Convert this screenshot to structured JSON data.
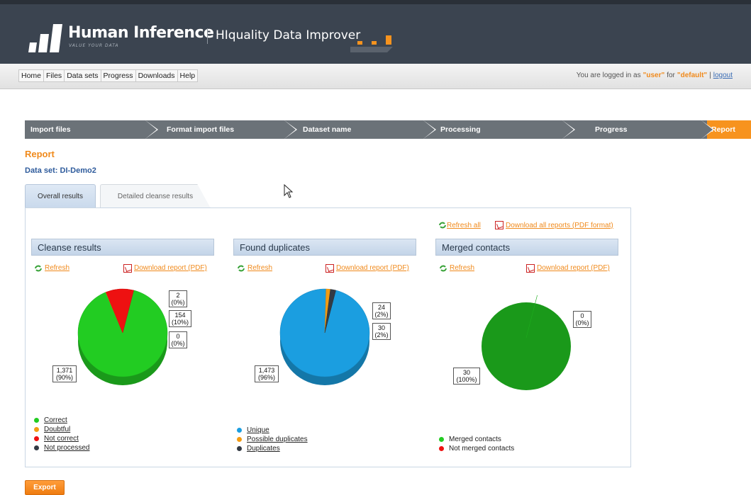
{
  "brand": {
    "company": "Human Inference",
    "tagline": "VALUE YOUR DATA",
    "product": "HIquality Data Improver"
  },
  "menu": [
    "Home",
    "Files",
    "Data sets",
    "Progress",
    "Downloads",
    "Help"
  ],
  "login": {
    "prefix": "You are logged in as",
    "user": "\"user\"",
    "for": "for",
    "tenant": "\"default\"",
    "sep": "|",
    "logout": "logout"
  },
  "wizard": {
    "steps": [
      "Import files",
      "Format import files",
      "Dataset name",
      "Processing",
      "Progress",
      "Report"
    ],
    "active_index": 5,
    "active_color": "#f7931e",
    "inactive_color": "#6b7278"
  },
  "report_title": "Report",
  "dataset_label": "Data set: DI-Demo2",
  "tabs": {
    "overall": "Overall results",
    "detailed": "Detailed cleanse results"
  },
  "global_links": {
    "refresh_all": "Refresh all",
    "download_all": "Download all reports (PDF format)"
  },
  "sections": [
    {
      "title": "Cleanse results",
      "refresh": "Refresh",
      "download": "Download report (PDF)",
      "callouts": [
        {
          "value": "2",
          "pct": "(0%)"
        },
        {
          "value": "154",
          "pct": "(10%)"
        },
        {
          "value": "0",
          "pct": "(0%)"
        },
        {
          "value": "1,371",
          "pct": "(90%)"
        }
      ],
      "legend": [
        {
          "label": "Correct",
          "color": "#22cc22"
        },
        {
          "label": "Doubtful",
          "color": "#f39c12"
        },
        {
          "label": "Not correct",
          "color": "#ee1111"
        },
        {
          "label": "Not processed",
          "color": "#333a44"
        }
      ]
    },
    {
      "title": "Found duplicates",
      "refresh": "Refresh",
      "download": "Download report (PDF)",
      "callouts": [
        {
          "value": "24",
          "pct": "(2%)"
        },
        {
          "value": "30",
          "pct": "(2%)"
        },
        {
          "value": "1,473",
          "pct": "(96%)"
        }
      ],
      "legend": [
        {
          "label": "Unique",
          "color": "#1b9ee0"
        },
        {
          "label": "Possible duplicates",
          "color": "#f39c12"
        },
        {
          "label": "Duplicates",
          "color": "#333a44"
        }
      ]
    },
    {
      "title": "Merged contacts",
      "refresh": "Refresh",
      "callouts": [
        {
          "value": "0",
          "pct": "(0%)"
        },
        {
          "value": "30",
          "pct": "(100%)"
        }
      ],
      "download": "Download report (PDF)",
      "legend": [
        {
          "label": "Merged contacts",
          "color": "#22cc22"
        },
        {
          "label": "Not merged contacts",
          "color": "#ee1111"
        }
      ]
    }
  ],
  "export": "Export",
  "chart_data": [
    {
      "type": "pie",
      "title": "Cleanse results",
      "categories": [
        "Correct",
        "Doubtful",
        "Not correct",
        "Not processed"
      ],
      "values": [
        1371,
        2,
        154,
        0
      ]
    },
    {
      "type": "pie",
      "title": "Found duplicates",
      "categories": [
        "Unique",
        "Possible duplicates",
        "Duplicates"
      ],
      "values": [
        1473,
        24,
        30
      ]
    },
    {
      "type": "pie",
      "title": "Merged contacts",
      "categories": [
        "Merged contacts",
        "Not merged contacts"
      ],
      "values": [
        30,
        0
      ]
    }
  ]
}
